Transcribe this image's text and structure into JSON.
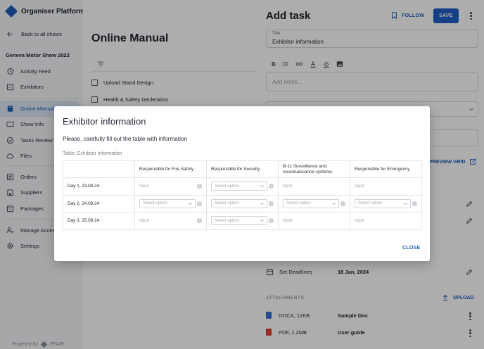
{
  "brand": {
    "name": "Organiser Platform"
  },
  "sidebar": {
    "back_label": "Back to all shows",
    "show_name": "Geneva Motor Show 2022",
    "group1": [
      {
        "label": "Activity Feed",
        "icon": "history-icon"
      },
      {
        "label": "Exhibitors",
        "icon": "building-icon"
      }
    ],
    "group2": [
      {
        "label": "Online Manual",
        "icon": "book-icon",
        "active": true
      },
      {
        "label": "Show Info",
        "icon": "open-book-icon"
      },
      {
        "label": "Tasks Review",
        "icon": "check-circle-icon"
      },
      {
        "label": "Files",
        "icon": "cloud-icon"
      }
    ],
    "group3": [
      {
        "label": "Orders",
        "icon": "list-icon"
      },
      {
        "label": "Suppliers",
        "icon": "store-icon"
      },
      {
        "label": "Packages",
        "icon": "package-icon"
      }
    ],
    "group4": [
      {
        "label": "Manage Access",
        "icon": "manage-access-icon"
      },
      {
        "label": "Settings",
        "icon": "gear-icon"
      }
    ],
    "powered_by": "Powered by",
    "powered_brand": "PFAIR"
  },
  "content": {
    "title": "Online Manual",
    "tasks": [
      "Upload Stand Design",
      "Health & Safety Decleration"
    ]
  },
  "panel": {
    "title": "Add task",
    "follow_label": "FOLLOW",
    "save_label": "SAVE",
    "title_field_label": "Title",
    "title_field_value": "Exhibitor information",
    "notes_placeholder": "Add notes...",
    "preview_label": "PREVIEW GRID",
    "deadline_label": "Set Deadlines",
    "deadline_value": "18 Jan, 2024",
    "attachments_label": "ATTACHMENTS",
    "upload_label": "UPLOAD",
    "files": [
      {
        "meta": "DOCX, 12KB",
        "name": "Sample Doc",
        "color": "#2f6fd6"
      },
      {
        "meta": "PDF, 1.2MB",
        "name": "User guide",
        "color": "#e03b36"
      }
    ]
  },
  "modal": {
    "title": "Exhibitor information",
    "subtitle": "Please, carefully fill out the table with information",
    "caption": "Table: Exhibitor information",
    "columns": [
      "",
      "Responsible for Fire Safety",
      "Responsible for Security",
      "B-11 Surveillance and reconnaissance systems.",
      "Responsible for Emergency"
    ],
    "input_placeholder": "Input",
    "select_placeholder": "Select option",
    "rows": [
      {
        "label": "Day 1,  23.08.24",
        "cells": [
          "input",
          "select",
          "input",
          "input"
        ]
      },
      {
        "label": "Day 2,  24.08.24",
        "cells": [
          "select",
          "select",
          "select",
          "select"
        ]
      },
      {
        "label": "Day 3, 25.08.24",
        "cells": [
          "input",
          "select",
          "input",
          "input"
        ]
      }
    ],
    "close_label": "CLOSE"
  },
  "colors": {
    "accent": "#1f5fc8",
    "link": "#1b5fb9",
    "active_bg": "#dfe8f5"
  }
}
